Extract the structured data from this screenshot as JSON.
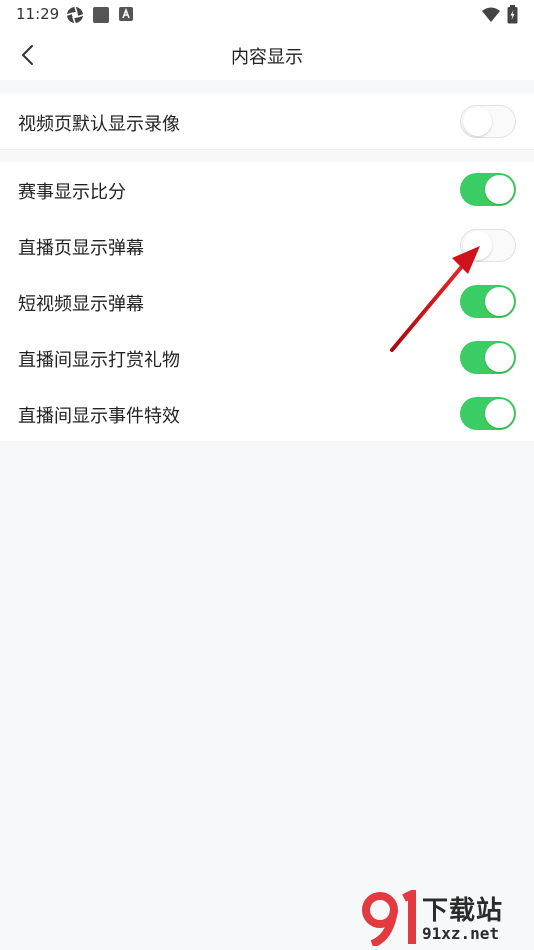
{
  "status_bar": {
    "time": "11:29"
  },
  "header": {
    "title": "内容显示"
  },
  "settings": {
    "group1": [
      {
        "label": "视频页默认显示录像",
        "state": "off"
      }
    ],
    "group2": [
      {
        "label": "赛事显示比分",
        "state": "on"
      },
      {
        "label": "直播页显示弹幕",
        "state": "off"
      },
      {
        "label": "短视频显示弹幕",
        "state": "on"
      },
      {
        "label": "直播间显示打赏礼物",
        "state": "on"
      },
      {
        "label": "直播间显示事件特效",
        "state": "on"
      }
    ]
  },
  "colors": {
    "toggle_on": "#3ccc64",
    "toggle_off": "#fafafa",
    "annotation_arrow": "#d0101a"
  },
  "watermark": {
    "text_cn": "下载站",
    "text_url": "91xz.net"
  }
}
